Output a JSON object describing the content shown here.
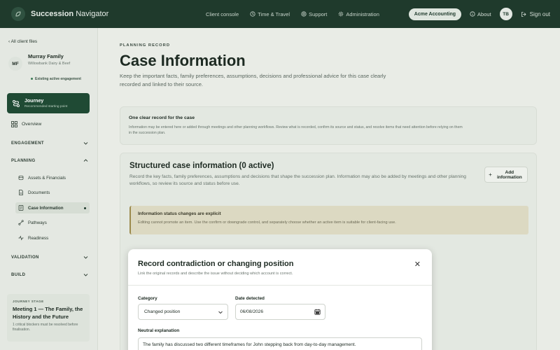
{
  "app": {
    "name_bold": "Succession",
    "name_rest": " Navigator"
  },
  "topnav": {
    "items": [
      {
        "label": "Client console",
        "icon": "none"
      },
      {
        "label": "Time & Travel",
        "icon": "clock-icon"
      },
      {
        "label": "Support",
        "icon": "support-icon"
      },
      {
        "label": "Administration",
        "icon": "gear-icon"
      }
    ],
    "org": "Acme Accounting",
    "about": "About",
    "user_initials": "TB",
    "signout": "Sign out"
  },
  "sidebar": {
    "back": "‹ All client files",
    "client": {
      "initials": "MF",
      "name": "Murray Family",
      "sub": "Willowbank Dairy & Beef",
      "status": "Existing active engagement"
    },
    "journey": {
      "title": "Journey",
      "sub": "Recommended starting point"
    },
    "overview": "Overview",
    "sections": {
      "engagement": "ENGAGEMENT",
      "planning": "PLANNING",
      "validation": "VALIDATION",
      "build": "BUILD"
    },
    "planning_items": [
      "Assets & Financials",
      "Documents",
      "Case Information",
      "Pathways",
      "Readiness"
    ],
    "stage": {
      "label": "JOURNEY STAGE",
      "title": "Meeting 1 — The Family, the History and the Future",
      "note": "1 critical blockers must be resolved before finalisation."
    }
  },
  "main": {
    "eyebrow": "PLANNING RECORD",
    "title": "Case Information",
    "description": "Keep the important facts, family preferences, assumptions, decisions and professional advice for this case clearly recorded and linked to their source.",
    "record_card": {
      "title": "One clear record for the case",
      "desc": "Information may be entered here or added through meetings and other planning workflows. Review what is recorded, confirm its source and status, and resolve items that need attention before relying on them in the succession plan."
    },
    "structured": {
      "title": "Structured case information (0 active)",
      "desc": "Record the key facts, family preferences, assumptions and decisions that shape the succession plan. Information may also be added by meetings and other planning workflows, so review its source and status before use.",
      "add_label": "Add information"
    },
    "notice": {
      "title": "Information status changes are explicit",
      "desc": "Editing cannot promote an item. Use the confirm or downgrade control, and separately choose whether an active item is suitable for client-facing use."
    }
  },
  "modal": {
    "title": "Record contradiction or changing position",
    "subtitle": "Link the original records and describe the issue without deciding which account is correct.",
    "close": "✕",
    "category_label": "Category",
    "category_value": "Changed position",
    "date_label": "Date detected",
    "date_value": "06/08/2026",
    "explanation_label": "Neutral explanation",
    "explanation_value": "The family has discussed two different timeframes for John stepping back from day-to-day management."
  }
}
